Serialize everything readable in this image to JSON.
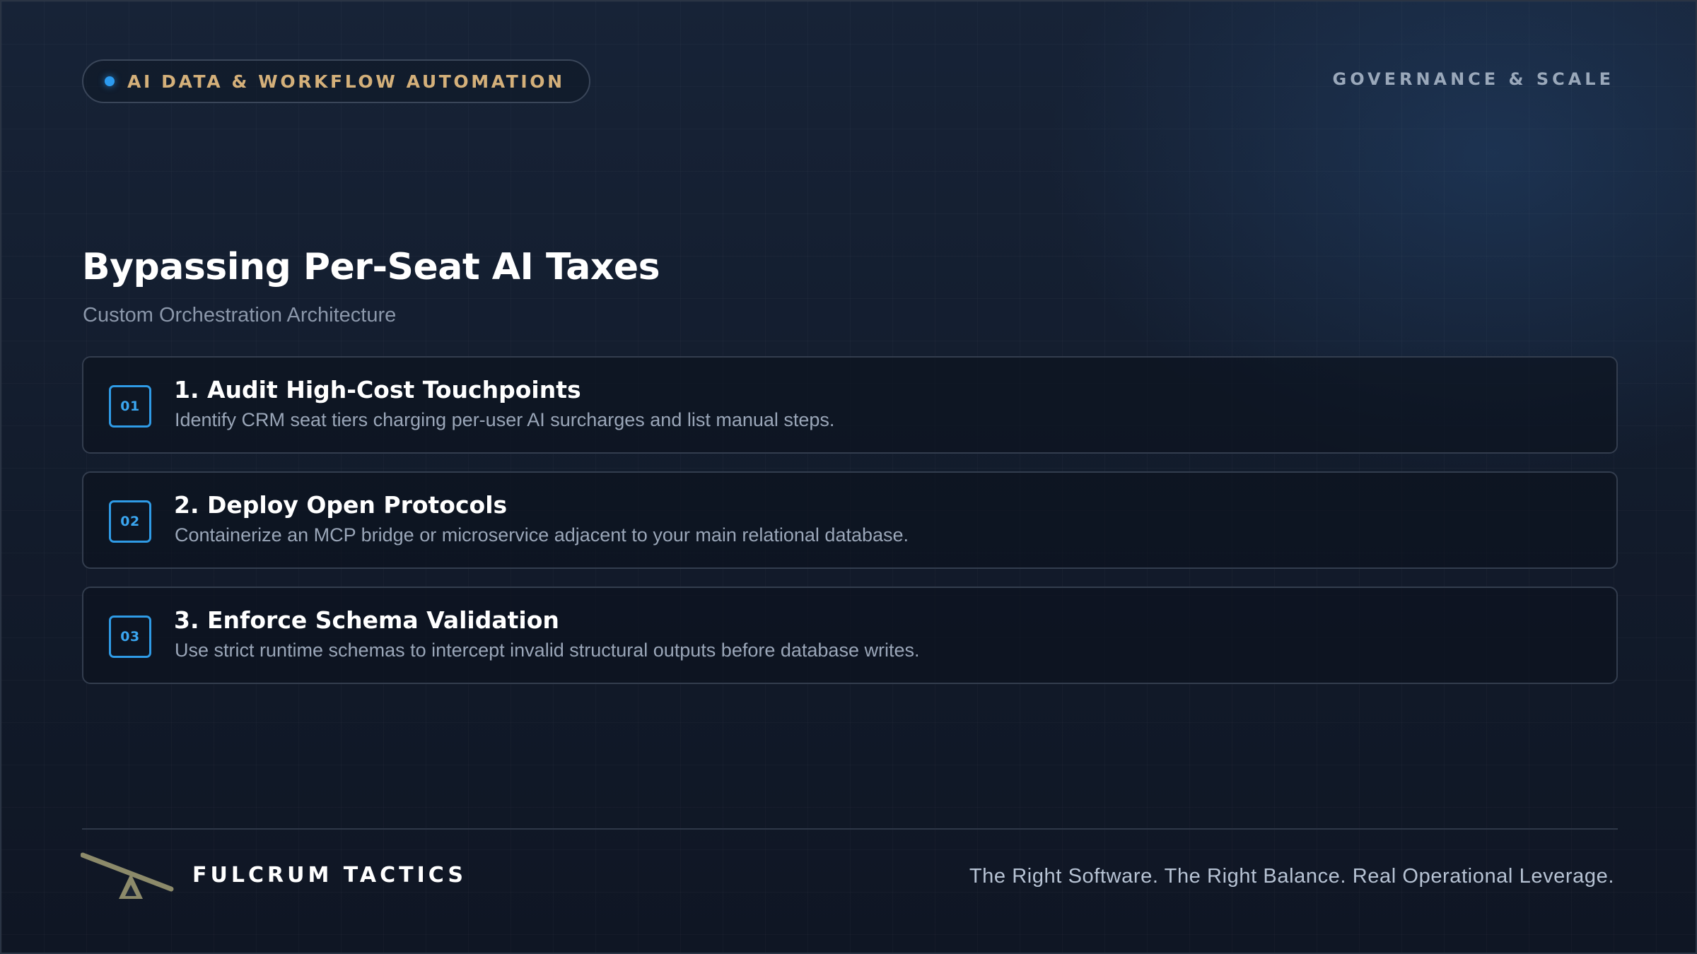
{
  "header": {
    "badge_label": "AI DATA & WORKFLOW AUTOMATION",
    "section_label": "GOVERNANCE & SCALE"
  },
  "main": {
    "title": "Bypassing Per-Seat AI Taxes",
    "subtitle": "Custom Orchestration Architecture",
    "steps": [
      {
        "number": "01",
        "title": "1. Audit High-Cost Touchpoints",
        "description": "Identify CRM seat tiers charging per-user AI surcharges and list manual steps."
      },
      {
        "number": "02",
        "title": "2. Deploy Open Protocols",
        "description": "Containerize an MCP bridge or microservice adjacent to your main relational database."
      },
      {
        "number": "03",
        "title": "3. Enforce Schema Validation",
        "description": "Use strict runtime schemas to intercept invalid structural outputs before database writes."
      }
    ]
  },
  "footer": {
    "brand": "FULCRUM TACTICS",
    "tagline": "The Right Software. The Right Balance. Real Operational Leverage.",
    "logo_icon": "seesaw-fulcrum-icon"
  },
  "colors": {
    "accent": "#2f9be6",
    "badge_text": "#d4b07a",
    "logo": "#8c8a6a",
    "background": "#131c2c"
  }
}
